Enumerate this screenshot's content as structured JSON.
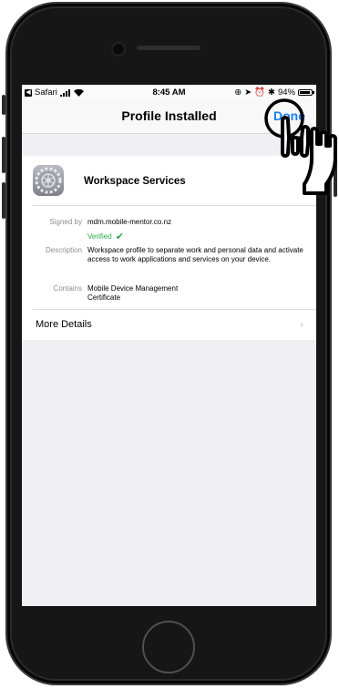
{
  "status_bar": {
    "carrier": "Safari",
    "time": "8:45 AM",
    "battery": "94%"
  },
  "nav": {
    "title": "Profile Installed",
    "done_label": "Done"
  },
  "profile": {
    "name": "Workspace Services",
    "signed_by_label": "Signed by",
    "signed_by_value": "mdm.mobile-mentor.co.nz",
    "verified_label": "Verified",
    "description_label": "Description",
    "description_value": "Workspace profile to separate work and personal data and activate access to work applications and services on your device.",
    "contains_label": "Contains",
    "contains_value_1": "Mobile Device Management",
    "contains_value_2": "Certificate",
    "more_details_label": "More Details"
  },
  "colors": {
    "accent": "#1a7cf5",
    "verified": "#2ca845",
    "background": "#efeff4"
  }
}
